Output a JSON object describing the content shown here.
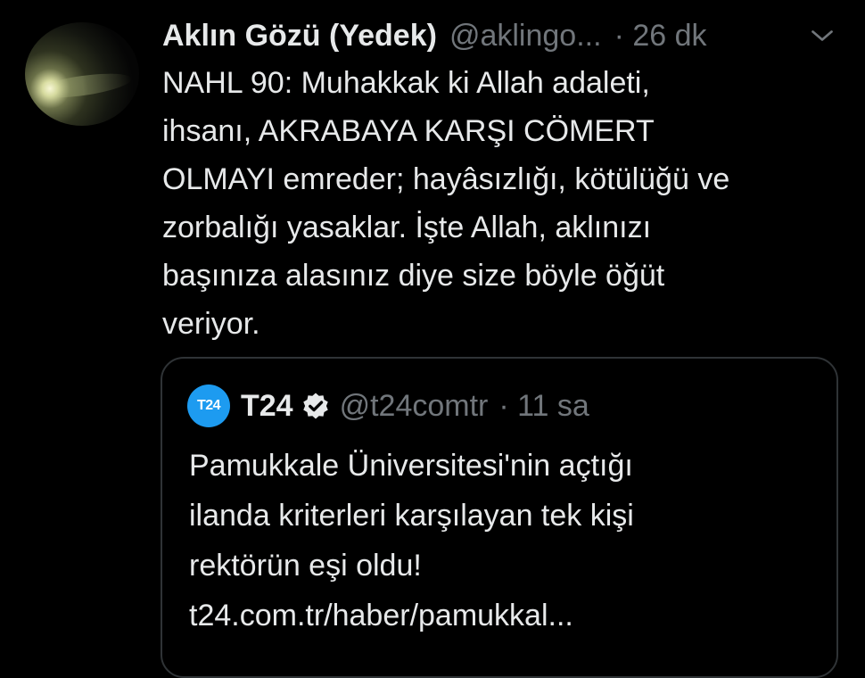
{
  "tweet": {
    "author_name": "Aklın Gözü (Yedek)",
    "handle": "@aklingo...",
    "time": "· 26 dk",
    "lines": [
      "NAHL 90: Muhakkak ki Allah adaleti,",
      "ihsanı, AKRABAYA KARŞI CÖMERT",
      "OLMAYI emreder; hayâsızlığı, kötülüğü ve",
      "zorbalığı yasaklar. İşte Allah, aklınızı",
      "başınıza alasınız diye size böyle öğüt",
      "veriyor."
    ]
  },
  "quote": {
    "logo_text": "T24",
    "author_name": "T24",
    "handle": "@t24comtr",
    "time": "· 11 sa",
    "lines": [
      "Pamukkale Üniversitesi'nin açtığı",
      "ilanda kriterleri karşılayan tek kişi",
      "rektörün eşi oldu!",
      "t24.com.tr/haber/pamukkal..."
    ]
  },
  "icons": {
    "avatar": "avatar-image",
    "more": "chevron-down-icon",
    "verified": "verified-badge-icon"
  },
  "colors": {
    "background": "#000000",
    "text_primary": "#e7e9ea",
    "text_secondary": "#71767b",
    "border": "#2f3336",
    "t24_blue": "#1d9bf0"
  }
}
